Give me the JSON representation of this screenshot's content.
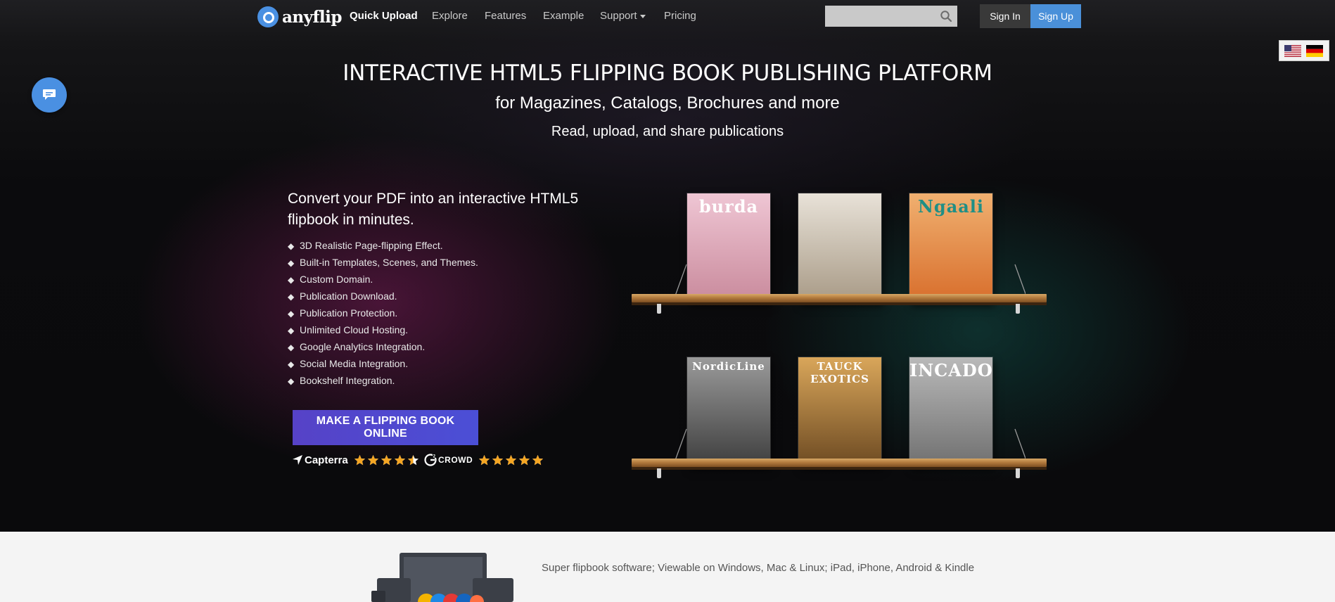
{
  "nav": {
    "logo": "anyflip",
    "items": [
      {
        "label": "Quick Upload"
      },
      {
        "label": "Explore"
      },
      {
        "label": "Features"
      },
      {
        "label": "Example"
      },
      {
        "label": "Support"
      },
      {
        "label": "Pricing"
      }
    ],
    "search_placeholder": "",
    "signin_label": "Sign In",
    "signup_label": "Sign Up"
  },
  "hero": {
    "headline": "INTERACTIVE HTML5 FLIPPING BOOK PUBLISHING PLATFORM",
    "subheadline": "for Magazines, Catalogs, Brochures and more",
    "tagline": "Read, upload, and share publications",
    "intro": "Convert your PDF into an interactive HTML5 flipbook in minutes.",
    "features": [
      "3D Realistic Page-flipping Effect.",
      "Built-in Templates, Scenes, and Themes.",
      "Custom Domain.",
      "Publication Download.",
      "Publication Protection.",
      "Unlimited Cloud Hosting.",
      "Google Analytics Integration.",
      "Social Media Integration.",
      "Bookshelf Integration."
    ],
    "cta_label": "MAKE A FLIPPING BOOK ONLINE",
    "ratings": [
      {
        "brand": "Capterra",
        "stars": 4.5
      },
      {
        "brand": "CROWD",
        "stars": 5
      }
    ]
  },
  "shelves": {
    "top": [
      {
        "title": "burda",
        "colors": [
          "#efc6d4",
          "#c98a9c"
        ],
        "text_color": "#ffffff"
      },
      {
        "title": "",
        "colors": [
          "#e8e2d8",
          "#a89a86"
        ],
        "text_color": "#ffffff"
      },
      {
        "title": "Ngaali",
        "colors": [
          "#f0b070",
          "#d86e2c"
        ],
        "text_color": "#1f8f86"
      }
    ],
    "bottom": [
      {
        "title": "NordicLine",
        "colors": [
          "#9a9a9a",
          "#3e3e3e"
        ],
        "text_color": "#ffffff"
      },
      {
        "title": "TAUCK EXOTICS",
        "colors": [
          "#d9a65a",
          "#6d4a22"
        ],
        "text_color": "#ffffff"
      },
      {
        "title": "INCADO",
        "colors": [
          "#b9b9b9",
          "#707070"
        ],
        "text_color": "#ffffff"
      }
    ]
  },
  "strip": {
    "caption": "Super flipbook software; Viewable on Windows, Mac & Linux; iPad, iPhone, Android & Kindle"
  },
  "colors": {
    "accent_blue": "#4a90e2",
    "cta_purple": "#5642c7",
    "star_orange": "#f5a623"
  }
}
